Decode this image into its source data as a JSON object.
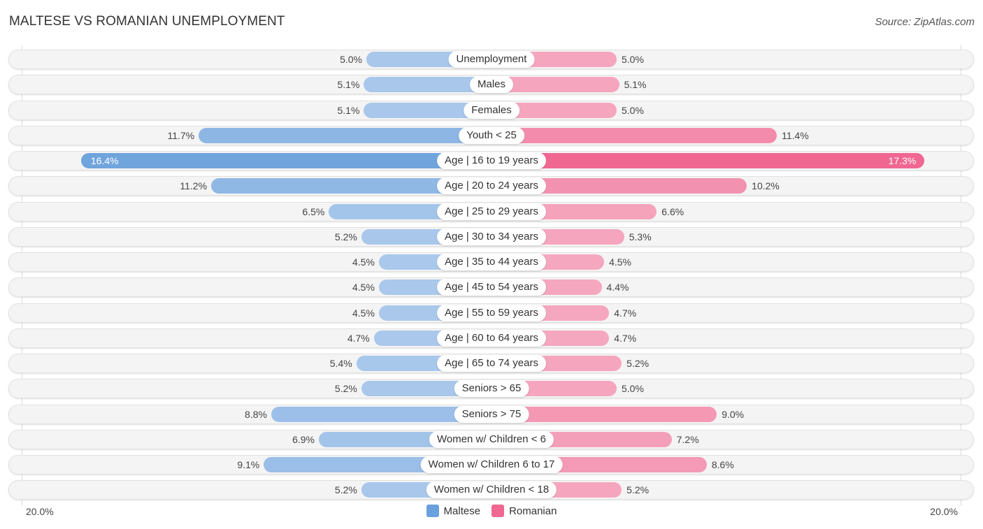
{
  "header": {
    "title": "MALTESE VS ROMANIAN UNEMPLOYMENT",
    "source": "Source: ZipAtlas.com"
  },
  "chart_data": {
    "type": "bar",
    "orientation": "horizontal-diverging",
    "title": "MALTESE VS ROMANIAN UNEMPLOYMENT",
    "xlim": [
      -20.0,
      20.0
    ],
    "axis_labels": {
      "left": "20.0%",
      "right": "20.0%"
    },
    "legend": {
      "position": "bottom-center",
      "entries": [
        "Maltese",
        "Romanian"
      ]
    },
    "colors": {
      "Maltese": "#6aa0dc",
      "Romanian": "#f06792",
      "Maltese_light": "#a9c8eb",
      "Romanian_light": "#f5a7bf"
    },
    "categories": [
      "Unemployment",
      "Males",
      "Females",
      "Youth < 25",
      "Age | 16 to 19 years",
      "Age | 20 to 24 years",
      "Age | 25 to 29 years",
      "Age | 30 to 34 years",
      "Age | 35 to 44 years",
      "Age | 45 to 54 years",
      "Age | 55 to 59 years",
      "Age | 60 to 64 years",
      "Age | 65 to 74 years",
      "Seniors > 65",
      "Seniors > 75",
      "Women w/ Children < 6",
      "Women w/ Children 6 to 17",
      "Women w/ Children < 18"
    ],
    "series": [
      {
        "name": "Maltese",
        "side": "left",
        "values": [
          5.0,
          5.1,
          5.1,
          11.7,
          16.4,
          11.2,
          6.5,
          5.2,
          4.5,
          4.5,
          4.5,
          4.7,
          5.4,
          5.2,
          8.8,
          6.9,
          9.1,
          5.2
        ],
        "labels": [
          "5.0%",
          "5.1%",
          "5.1%",
          "11.7%",
          "16.4%",
          "11.2%",
          "6.5%",
          "5.2%",
          "4.5%",
          "4.5%",
          "4.5%",
          "4.7%",
          "5.4%",
          "5.2%",
          "8.8%",
          "6.9%",
          "9.1%",
          "5.2%"
        ]
      },
      {
        "name": "Romanian",
        "side": "right",
        "values": [
          5.0,
          5.1,
          5.0,
          11.4,
          17.3,
          10.2,
          6.6,
          5.3,
          4.5,
          4.4,
          4.7,
          4.7,
          5.2,
          5.0,
          9.0,
          7.2,
          8.6,
          5.2
        ],
        "labels": [
          "5.0%",
          "5.1%",
          "5.0%",
          "11.4%",
          "17.3%",
          "10.2%",
          "6.6%",
          "5.3%",
          "4.5%",
          "4.4%",
          "4.7%",
          "4.7%",
          "5.2%",
          "5.0%",
          "9.0%",
          "7.2%",
          "8.6%",
          "5.2%"
        ]
      }
    ]
  }
}
